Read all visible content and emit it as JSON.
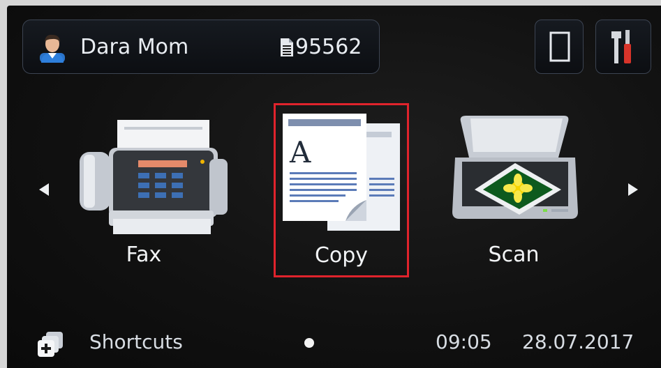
{
  "user_bar": {
    "user_name": "Dara Mom",
    "counter": "95562"
  },
  "tiles": [
    {
      "label": "Fax"
    },
    {
      "label": "Copy"
    },
    {
      "label": "Scan"
    }
  ],
  "copy_icon_letter": "A",
  "bottom_bar": {
    "shortcuts_label": "Shortcuts",
    "time": "09:05",
    "date": "28.07.2017"
  },
  "icons": {
    "user": "user-icon",
    "document": "document-icon",
    "paper": "paper-icon",
    "tools": "tools-icon",
    "fax": "fax-icon",
    "copy": "copy-icon",
    "scan": "scan-icon",
    "shortcuts": "shortcuts-icon",
    "arrow_left": "arrow-left-icon",
    "arrow_right": "arrow-right-icon"
  },
  "colors": {
    "selection": "#e0232c",
    "screen_bg": "#111111",
    "text": "#f2f4f6"
  }
}
